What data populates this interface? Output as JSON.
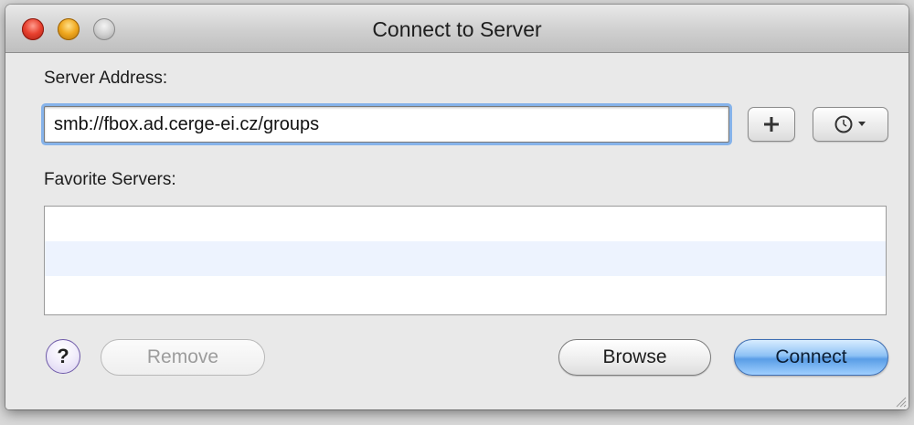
{
  "window": {
    "title": "Connect to Server",
    "controls": {
      "close_color": "#e8412f",
      "minimize_color": "#f0a81f",
      "zoom_color": "#cfcfcf"
    }
  },
  "server_address": {
    "label": "Server Address:",
    "value": "smb://fbox.ad.cerge-ei.cz/groups",
    "add_button_icon": "plus-icon",
    "recent_button_icon": "clock-dropdown-icon"
  },
  "favorites": {
    "label": "Favorite Servers:",
    "items": []
  },
  "buttons": {
    "help_label": "?",
    "remove_label": "Remove",
    "browse_label": "Browse",
    "connect_label": "Connect"
  },
  "colors": {
    "accent": "#5a9de6",
    "focus_ring": "#86b3ea",
    "list_alt_row": "#edf3fe"
  }
}
